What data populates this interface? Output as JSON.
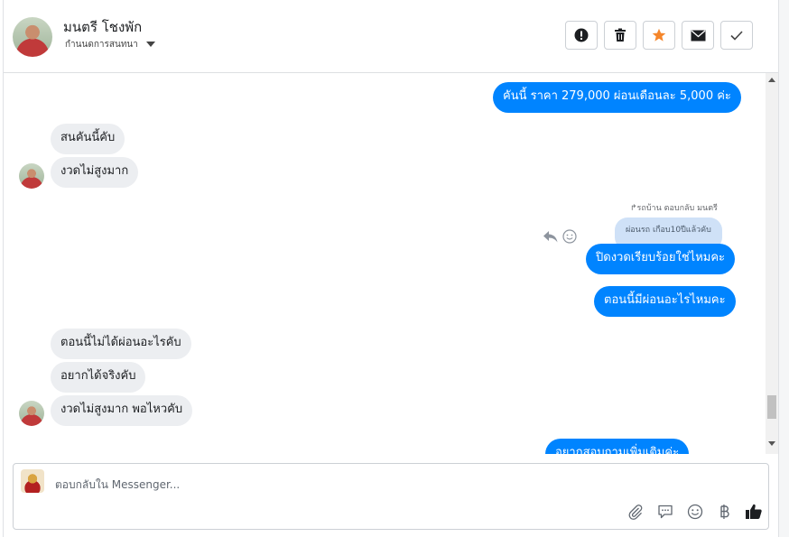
{
  "header": {
    "contact_name": "มนตรี โชงพัก",
    "contact_status": "กำนนดการสนทนา",
    "actions": [
      "mark-spam",
      "delete",
      "star",
      "mark-unread",
      "done"
    ]
  },
  "messages": {
    "m1": "คันนี้ ราคา 279,000  ผ่อนเดือนละ 5,000 ค่ะ",
    "m2": "สนคันนี้คับ",
    "m3": "งวดไม่สูงมาก",
    "reply_note": "↱รถบ้าน ตอบกลับ มนตรี",
    "quoted": "ผ่อนรถ เกือบ10ปีแล้วคับ",
    "m4": "ปิดงวดเรียบร้อยใช่ไหมคะ",
    "m5": "ตอนนี้มีผ่อนอะไรไหมคะ",
    "m6": "ตอนนี้ไม่ได้ผ่อนอะไรคับ",
    "m7": "อยากได้จริงคับ",
    "m8": "งวดไม่สูงมาก พอไหวคับ",
    "m9": "อยากสอบถามเพิ่มเติมค่ะ"
  },
  "composer": {
    "placeholder": "ตอบกลับใน Messenger...",
    "tools": [
      "attach-icon",
      "chat-icon",
      "emoji-icon",
      "baht-icon",
      "thumbs-up-icon"
    ]
  },
  "colors": {
    "accent": "#0084ff",
    "incoming": "#eceef1",
    "quoted": "#cfe1f7",
    "star": "#f5862b"
  }
}
